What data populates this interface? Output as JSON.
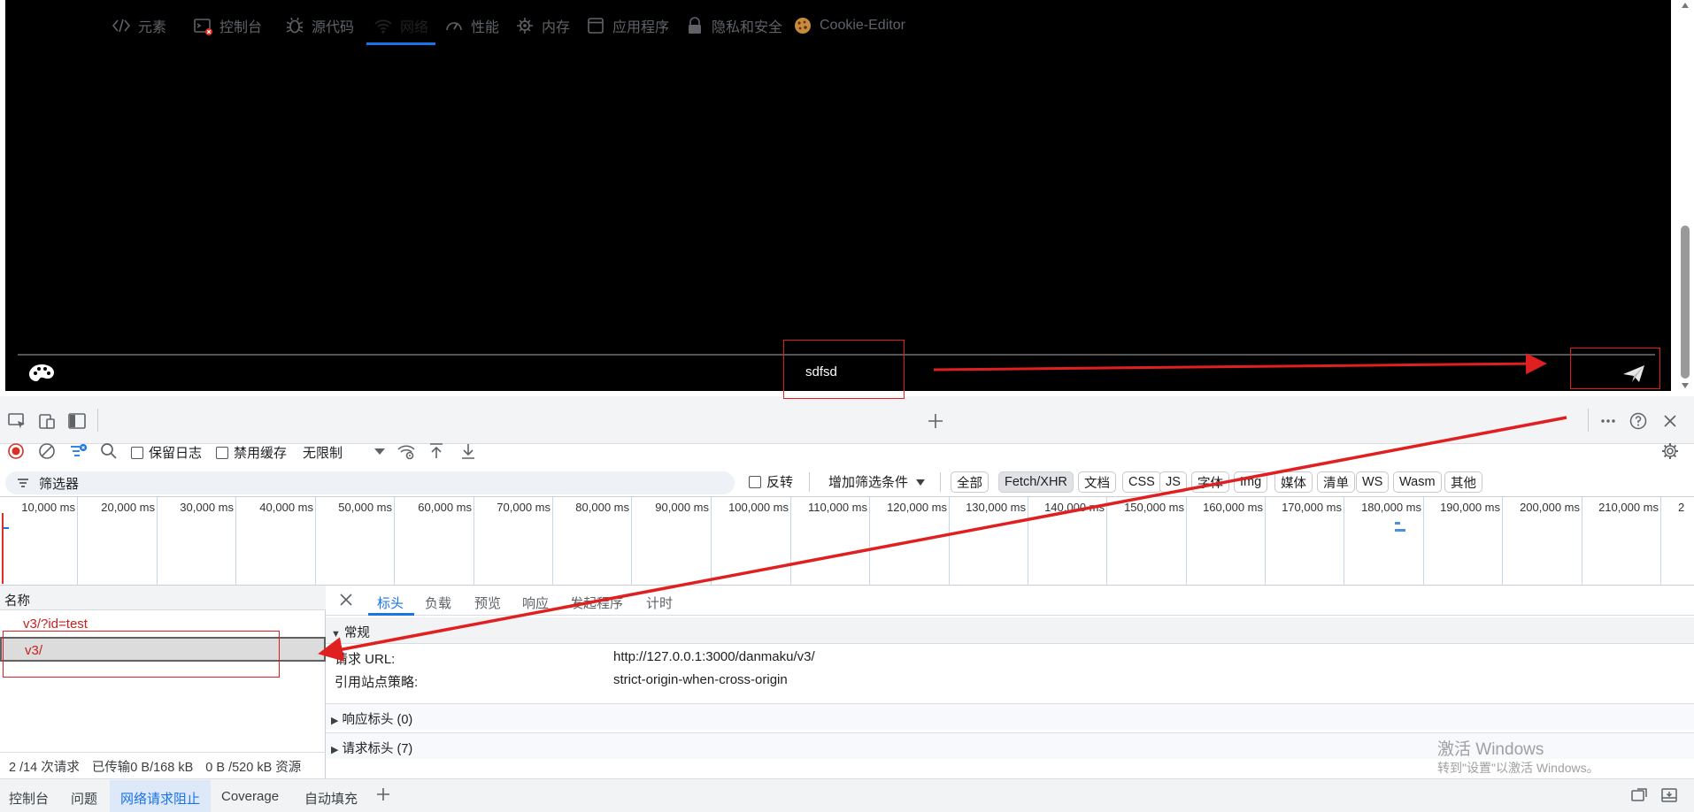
{
  "player": {
    "danmaku_text": "sdfsd",
    "palette_icon": "palette-icon",
    "send_icon": "send-paper-plane-icon"
  },
  "devtools": {
    "tabs": [
      {
        "label": "元素",
        "icon": "code-brackets-icon"
      },
      {
        "label": "控制台",
        "icon": "console-icon"
      },
      {
        "label": "源代码",
        "icon": "bug-icon"
      },
      {
        "label": "网络",
        "icon": "wifi-icon",
        "active": true
      },
      {
        "label": "性能",
        "icon": "gauge-icon"
      },
      {
        "label": "内存",
        "icon": "chip-icon"
      },
      {
        "label": "应用程序",
        "icon": "window-icon"
      },
      {
        "label": "隐私和安全",
        "icon": "lock-icon"
      },
      {
        "label": "Cookie-Editor",
        "icon": "cookie-icon"
      }
    ],
    "toolbar": {
      "preserve_log": "保留日志",
      "disable_cache": "禁用缓存",
      "throttle": "无限制"
    },
    "filter": {
      "placeholder": "筛选器",
      "invert": "反转",
      "more_filters": "增加筛选条件",
      "types": [
        "全部",
        "Fetch/XHR",
        "文档",
        "CSS",
        "JS",
        "字体",
        "Img",
        "媒体",
        "清单",
        "WS",
        "Wasm",
        "其他"
      ],
      "selected_type": "Fetch/XHR"
    },
    "timeline": {
      "ticks": [
        "10,000 ms",
        "20,000 ms",
        "30,000 ms",
        "40,000 ms",
        "50,000 ms",
        "60,000 ms",
        "70,000 ms",
        "80,000 ms",
        "90,000 ms",
        "100,000 ms",
        "110,000 ms",
        "120,000 ms",
        "130,000 ms",
        "140,000 ms",
        "150,000 ms",
        "160,000 ms",
        "170,000 ms",
        "180,000 ms",
        "190,000 ms",
        "200,000 ms",
        "210,000 ms",
        "2"
      ]
    },
    "requests": {
      "column_name": "名称",
      "rows": [
        "v3/?id=test",
        "v3/"
      ],
      "summary": {
        "requests": "2 /14 次请求",
        "transferred": "已传输0 B/168 kB",
        "resources": "0 B /520 kB 资源"
      }
    },
    "details": {
      "tabs": [
        "标头",
        "负载",
        "预览",
        "响应",
        "发起程序",
        "计时"
      ],
      "active_tab": "标头",
      "general_title": "常规",
      "request_url_key": "请求 URL:",
      "request_url_value": "http://127.0.0.1:3000/danmaku/v3/",
      "referrer_key": "引用站点策略:",
      "referrer_value": "strict-origin-when-cross-origin",
      "response_headers": "响应标头 (0)",
      "request_headers": "请求标头 (7)"
    },
    "drawer": {
      "tabs": [
        "控制台",
        "问题",
        "网络请求阻止",
        "Coverage",
        "自动填充"
      ],
      "active_tab": "网络请求阻止"
    }
  },
  "watermark": {
    "line1": "激活 Windows",
    "line2": "转到\"设置\"以激活 Windows。"
  },
  "colors": {
    "accent": "#1a73e8",
    "annotation_red": "#e02020",
    "request_text": "#c5221f"
  }
}
